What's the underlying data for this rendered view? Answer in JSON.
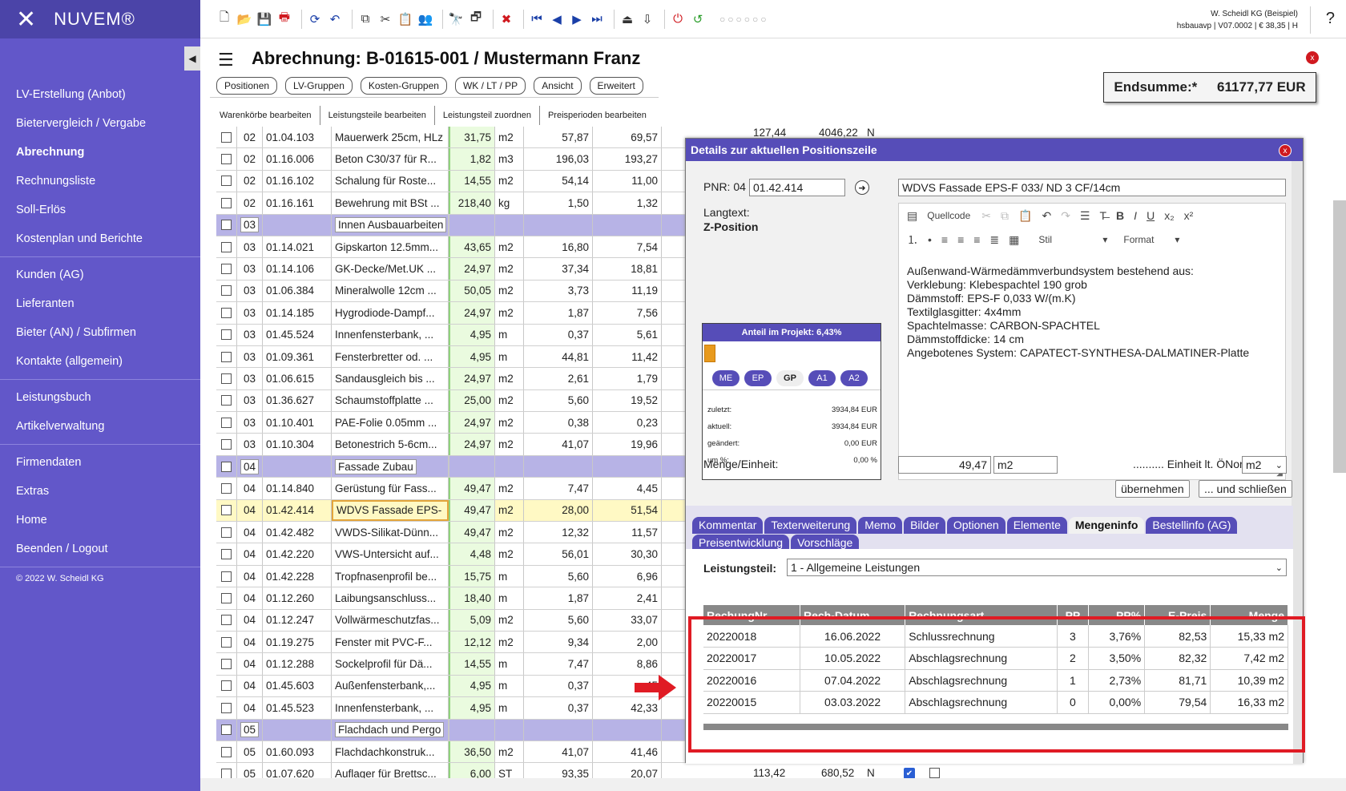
{
  "app": {
    "logo_mark": "✕",
    "logo_text": "NUVEM®",
    "company_line1": "W. Scheidl KG (Beispiel)",
    "company_line2": "hsbauavp | V07.0002 | € 38,35 | H",
    "help": "?"
  },
  "sidebar": {
    "groups": [
      [
        "LV-Erstellung (Anbot)",
        "Bietervergleich / Vergabe",
        "Abrechnung",
        "Rechnungsliste",
        "Soll-Erlös",
        "Kostenplan und Berichte"
      ],
      [
        "Kunden (AG)",
        "Lieferanten",
        "Bieter (AN) / Subfirmen",
        "Kontakte (allgemein)"
      ],
      [
        "Leistungsbuch",
        "Artikelverwaltung"
      ],
      [
        "Firmendaten",
        "Extras",
        "Home",
        "Beenden / Logout"
      ]
    ],
    "active": "Abrechnung",
    "copyright": "© 2022 W. Scheidl KG"
  },
  "page": {
    "title": "Abrechnung: B-01615-001 / Mustermann Franz",
    "endsumme_label": "Endsumme:*",
    "endsumme_value": "61177,77 EUR"
  },
  "tabs": [
    "Positionen",
    "LV-Gruppen",
    "Kosten-Gruppen",
    "WK / LT / PP",
    "Ansicht",
    "Erweitert"
  ],
  "subtabs": [
    "Warenkörbe bearbeiten",
    "Leistungsteile bearbeiten",
    "Leistungsteil zuordnen",
    "Preisperioden bearbeiten"
  ],
  "grid_rows": [
    {
      "grp": "02",
      "pos": "01.04.103",
      "txt": "Mauerwerk 25cm, HLz",
      "qty": "31,75",
      "unit": "m2",
      "ep": "57,87",
      "gp": "69,57"
    },
    {
      "grp": "02",
      "pos": "01.16.006",
      "txt": "Beton C30/37 für R...",
      "qty": "1,82",
      "unit": "m3",
      "ep": "196,03",
      "gp": "193,27"
    },
    {
      "grp": "02",
      "pos": "01.16.102",
      "txt": "Schalung für Roste...",
      "qty": "14,55",
      "unit": "m2",
      "ep": "54,14",
      "gp": "11,00"
    },
    {
      "grp": "02",
      "pos": "01.16.161",
      "txt": "Bewehrung mit BSt ...",
      "qty": "218,40",
      "unit": "kg",
      "ep": "1,50",
      "gp": "1,32"
    },
    {
      "group": true,
      "grp": "03",
      "txt": "Innen Ausbauarbeiten"
    },
    {
      "grp": "03",
      "pos": "01.14.021",
      "txt": "Gipskarton 12.5mm...",
      "qty": "43,65",
      "unit": "m2",
      "ep": "16,80",
      "gp": "7,54"
    },
    {
      "grp": "03",
      "pos": "01.14.106",
      "txt": "GK-Decke/Met.UK ...",
      "qty": "24,97",
      "unit": "m2",
      "ep": "37,34",
      "gp": "18,81"
    },
    {
      "grp": "03",
      "pos": "01.06.384",
      "txt": "Mineralwolle 12cm ...",
      "qty": "50,05",
      "unit": "m2",
      "ep": "3,73",
      "gp": "11,19"
    },
    {
      "grp": "03",
      "pos": "01.14.185",
      "txt": "Hygrodiode-Dampf...",
      "qty": "24,97",
      "unit": "m2",
      "ep": "1,87",
      "gp": "7,56"
    },
    {
      "grp": "03",
      "pos": "01.45.524",
      "txt": "Innenfensterbank, ...",
      "qty": "4,95",
      "unit": "m",
      "ep": "0,37",
      "gp": "5,61"
    },
    {
      "grp": "03",
      "pos": "01.09.361",
      "txt": "Fensterbretter od. ...",
      "qty": "4,95",
      "unit": "m",
      "ep": "44,81",
      "gp": "11,42"
    },
    {
      "grp": "03",
      "pos": "01.06.615",
      "txt": "Sandausgleich bis ...",
      "qty": "24,97",
      "unit": "m2",
      "ep": "2,61",
      "gp": "1,79"
    },
    {
      "grp": "03",
      "pos": "01.36.627",
      "txt": "Schaumstoffplatte ...",
      "qty": "25,00",
      "unit": "m2",
      "ep": "5,60",
      "gp": "19,52"
    },
    {
      "grp": "03",
      "pos": "01.10.401",
      "txt": "PAE-Folie 0.05mm ...",
      "qty": "24,97",
      "unit": "m2",
      "ep": "0,38",
      "gp": "0,23"
    },
    {
      "grp": "03",
      "pos": "01.10.304",
      "txt": "Betonestrich 5-6cm...",
      "qty": "24,97",
      "unit": "m2",
      "ep": "41,07",
      "gp": "19,96"
    },
    {
      "group": true,
      "grp": "04",
      "txt": "Fassade Zubau"
    },
    {
      "grp": "04",
      "pos": "01.14.840",
      "txt": "Gerüstung für Fass...",
      "qty": "49,47",
      "unit": "m2",
      "ep": "7,47",
      "gp": "4,45"
    },
    {
      "sel": true,
      "grp": "04",
      "pos": "01.42.414",
      "txt": "WDVS Fassade EPS-",
      "qty": "49,47",
      "unit": "m2",
      "ep": "28,00",
      "gp": "51,54"
    },
    {
      "grp": "04",
      "pos": "01.42.482",
      "txt": "VWDS-Silikat-Dünn...",
      "qty": "49,47",
      "unit": "m2",
      "ep": "12,32",
      "gp": "11,57"
    },
    {
      "grp": "04",
      "pos": "01.42.220",
      "txt": "VWS-Untersicht auf...",
      "qty": "4,48",
      "unit": "m2",
      "ep": "56,01",
      "gp": "30,30"
    },
    {
      "grp": "04",
      "pos": "01.42.228",
      "txt": "Tropfnasenprofil be...",
      "qty": "15,75",
      "unit": "m",
      "ep": "5,60",
      "gp": "6,96"
    },
    {
      "grp": "04",
      "pos": "01.12.260",
      "txt": "Laibungsanschluss...",
      "qty": "18,40",
      "unit": "m",
      "ep": "1,87",
      "gp": "2,41"
    },
    {
      "grp": "04",
      "pos": "01.12.247",
      "txt": "Vollwärmeschutzfas...",
      "qty": "5,09",
      "unit": "m2",
      "ep": "5,60",
      "gp": "33,07"
    },
    {
      "grp": "04",
      "pos": "01.19.275",
      "txt": "Fenster mit PVC-F...",
      "qty": "12,12",
      "unit": "m2",
      "ep": "9,34",
      "gp": "2,00"
    },
    {
      "grp": "04",
      "pos": "01.12.288",
      "txt": "Sockelprofil für Dä...",
      "qty": "14,55",
      "unit": "m",
      "ep": "7,47",
      "gp": "8,86"
    },
    {
      "grp": "04",
      "pos": "01.45.603",
      "txt": "Außenfensterbank,...",
      "qty": "4,95",
      "unit": "m",
      "ep": "0,37",
      "gp": "45"
    },
    {
      "grp": "04",
      "pos": "01.45.523",
      "txt": "Innenfensterbank, ...",
      "qty": "4,95",
      "unit": "m",
      "ep": "0,37",
      "gp": "42,33"
    },
    {
      "group": true,
      "grp": "05",
      "txt": "Flachdach und Pergo"
    },
    {
      "grp": "05",
      "pos": "01.60.093",
      "txt": "Flachdachkonstruk...",
      "qty": "36,50",
      "unit": "m2",
      "ep": "41,07",
      "gp": "41,46"
    },
    {
      "grp": "05",
      "pos": "01.07.620",
      "txt": "Auflager für Brettsc...",
      "qty": "6,00",
      "unit": "ST",
      "ep": "93,35",
      "gp": "20,07"
    }
  ],
  "panel": {
    "title": "Details zur aktuellen Positionszeile",
    "pnr_label": "PNR: 04",
    "pnr_value": "01.42.414",
    "short_text": "WDVS Fassade EPS-F 033/ ND 3 CF/14cm",
    "langtext_label": "Langtext:",
    "zposition_label": "Z-Position",
    "editor_source": "Quellcode",
    "editor_style": "Stil",
    "editor_format": "Format",
    "long_text": [
      "Außenwand-Wärmedämmverbundsystem bestehend aus:",
      "Verklebung: Klebespachtel 190 grob",
      "Dämmstoff: EPS-F 0,033 W/(m.K)",
      "Textilglasgitter: 4x4mm",
      "Spachtelmasse: CARBON-SPACHTEL",
      "Dämmstoffdicke: 14 cm",
      "Angebotenes System: CAPATECT-SYNTHESA-DALMATINER-Platte"
    ],
    "share": {
      "title": "Anteil im Projekt: 6,43%",
      "tabs": [
        "ME",
        "EP",
        "GP",
        "A1",
        "A2"
      ],
      "active_tab": "GP",
      "rows": [
        {
          "label": "zuletzt:",
          "value": "3934,84 EUR"
        },
        {
          "label": "aktuell:",
          "value": "3934,84 EUR"
        },
        {
          "label": "geändert:",
          "value": "0,00 EUR"
        },
        {
          "label": "um %:",
          "value": "0,00 %"
        }
      ]
    },
    "menge_label": "Menge/Einheit:",
    "menge_value": "49,47",
    "einheit_value": "m2",
    "oenorm_label": ".......... Einheit lt. ÖNorm:",
    "oenorm_value": "m2",
    "btn_apply": "übernehmen",
    "btn_apply_close": "... und schließen",
    "tabs": [
      "Kommentar",
      "Texterweiterung",
      "Memo",
      "Bilder",
      "Optionen",
      "Elemente",
      "Mengeninfo",
      "Bestellinfo (AG)",
      "Preisentwicklung",
      "Vorschläge"
    ],
    "active_tab": "Mengeninfo",
    "leistungsteil_label": "Leistungsteil:",
    "leistungsteil_value": "1 - Allgemeine Leistungen",
    "table": {
      "headers": [
        "RechungNr",
        "Rech-Datum",
        "Rechnungsart",
        "PP",
        "PP%",
        "E-Preis",
        "Menge"
      ],
      "rows": [
        [
          "20220018",
          "16.06.2022",
          "Schlussrechnung",
          "3",
          "3,76%",
          "82,53",
          "15,33 m2"
        ],
        [
          "20220017",
          "10.05.2022",
          "Abschlagsrechnung",
          "2",
          "3,50%",
          "82,32",
          "7,42 m2"
        ],
        [
          "20220016",
          "07.04.2022",
          "Abschlagsrechnung",
          "1",
          "2,73%",
          "81,71",
          "10,39 m2"
        ],
        [
          "20220015",
          "03.03.2022",
          "Abschlagsrechnung",
          "0",
          "0,00%",
          "79,54",
          "16,33 m2"
        ]
      ]
    }
  },
  "bottom_row": {
    "gp": "113,42",
    "sum": "680,52",
    "n": "N"
  },
  "top_row": {
    "gp": "127,44",
    "sum": "4046,22",
    "n": "N"
  },
  "colors": {
    "sidebar": "#6257c9",
    "accent": "#564db8",
    "highlight": "#e01b24"
  }
}
